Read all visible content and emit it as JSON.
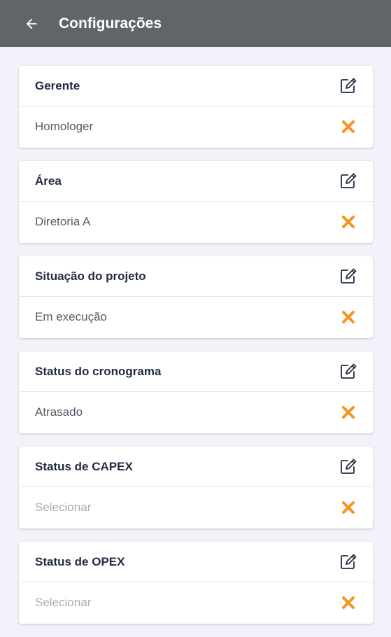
{
  "header": {
    "title": "Configurações",
    "back_icon": "arrow-left-icon"
  },
  "accent_color": "#f7931e",
  "fields": [
    {
      "label": "Gerente",
      "value": "Homologer",
      "is_placeholder": false
    },
    {
      "label": "Área",
      "value": "Diretoria A",
      "is_placeholder": false
    },
    {
      "label": "Situação do projeto",
      "value": "Em execução",
      "is_placeholder": false
    },
    {
      "label": "Status do cronograma",
      "value": "Atrasado",
      "is_placeholder": false
    },
    {
      "label": "Status de CAPEX",
      "value": "Selecionar",
      "is_placeholder": true
    },
    {
      "label": "Status de OPEX",
      "value": "Selecionar",
      "is_placeholder": true
    }
  ]
}
